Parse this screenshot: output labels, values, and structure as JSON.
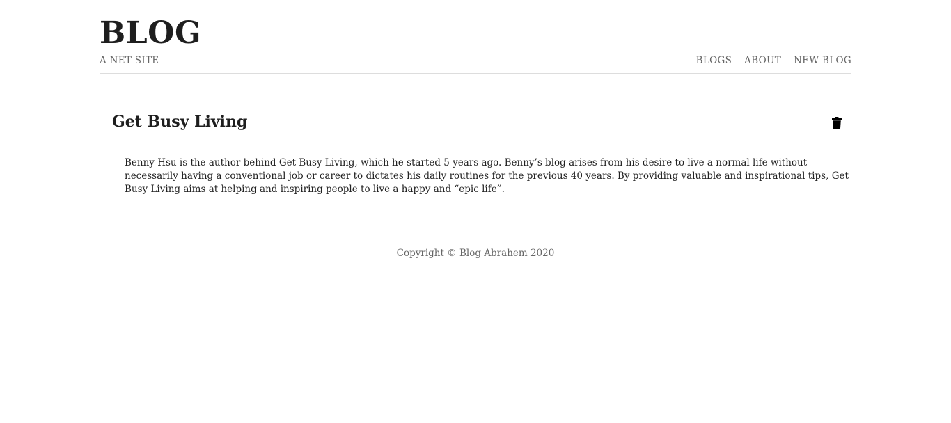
{
  "header": {
    "title": "BLOG",
    "tagline": "A NET SITE",
    "nav": [
      "BLOGS",
      "ABOUT",
      "NEW BLOG"
    ]
  },
  "post": {
    "title": "Get Busy Living",
    "delete_icon": "trash-icon",
    "body": "Benny Hsu is the author behind Get Busy Living, which he started 5 years ago. Benny’s blog arises from his desire to live a normal life without necessarily having a conventional job or career to dictates his daily routines for the previous 40 years. By providing valuable and inspirational tips, Get Busy Living aims at helping and inspiring people to live a happy and “epic life”."
  },
  "footer": {
    "copyright": "Copyright © Blog Abrahem 2020"
  }
}
